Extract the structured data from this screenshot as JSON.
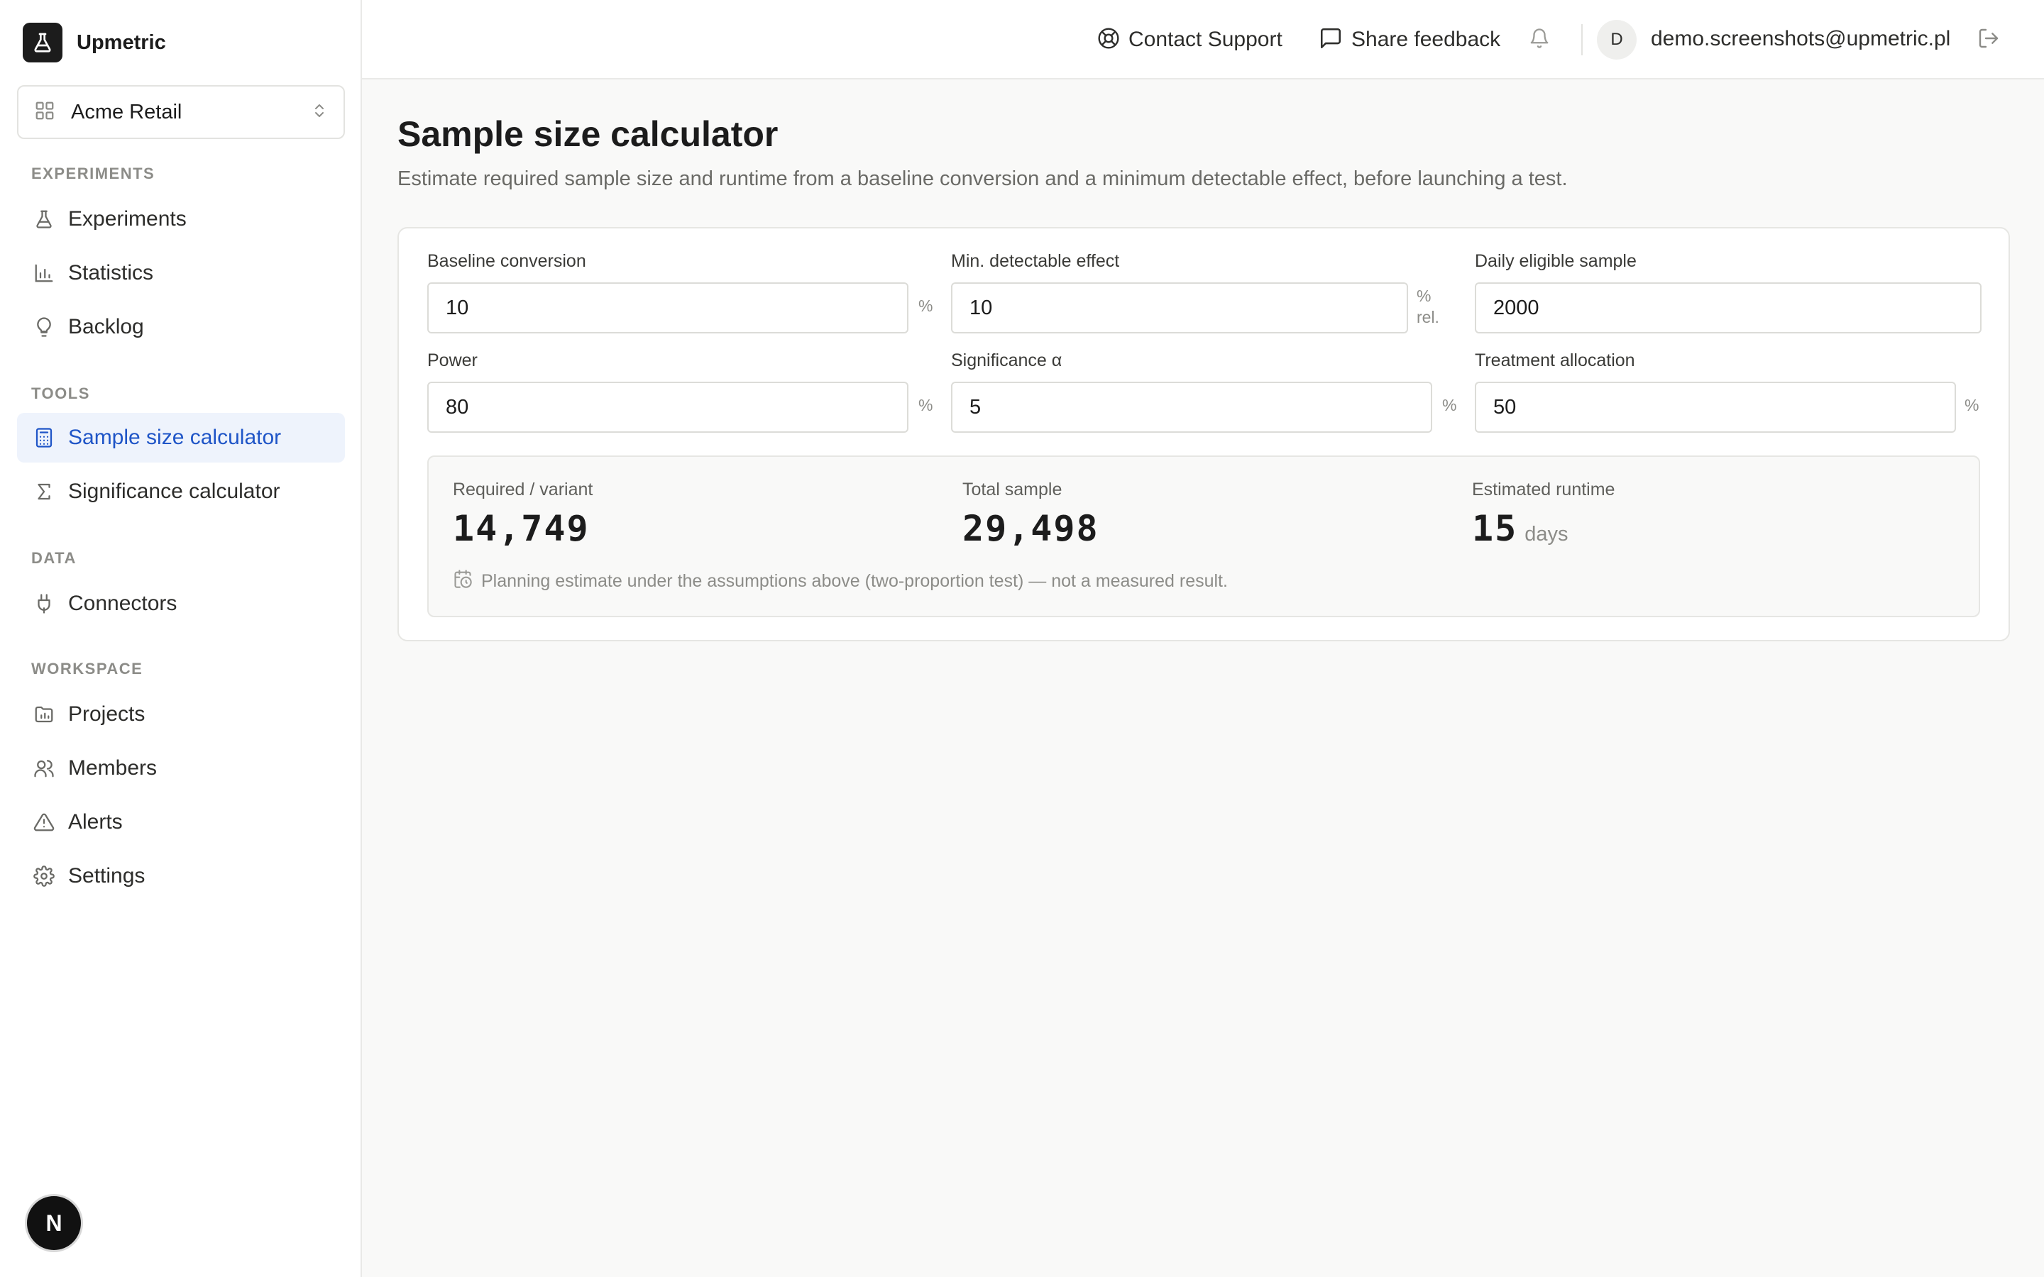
{
  "brand": {
    "name": "Upmetric"
  },
  "workspace": {
    "name": "Acme Retail"
  },
  "sidebar": {
    "sections": [
      {
        "title": "EXPERIMENTS",
        "items": [
          {
            "label": "Experiments",
            "icon": "flask-icon"
          },
          {
            "label": "Statistics",
            "icon": "bar-chart-icon"
          },
          {
            "label": "Backlog",
            "icon": "lightbulb-icon"
          }
        ]
      },
      {
        "title": "TOOLS",
        "items": [
          {
            "label": "Sample size calculator",
            "icon": "calculator-icon",
            "active": true
          },
          {
            "label": "Significance calculator",
            "icon": "sigma-icon"
          }
        ]
      },
      {
        "title": "DATA",
        "items": [
          {
            "label": "Connectors",
            "icon": "plug-icon"
          }
        ]
      },
      {
        "title": "WORKSPACE",
        "items": [
          {
            "label": "Projects",
            "icon": "folder-chart-icon"
          },
          {
            "label": "Members",
            "icon": "users-icon"
          },
          {
            "label": "Alerts",
            "icon": "alert-triangle-icon"
          },
          {
            "label": "Settings",
            "icon": "gear-icon"
          }
        ]
      }
    ]
  },
  "header": {
    "contact_support": "Contact Support",
    "share_feedback": "Share feedback",
    "avatar_initial": "D",
    "email": "demo.screenshots@upmetric.pl"
  },
  "page": {
    "title": "Sample size calculator",
    "subtitle": "Estimate required sample size and runtime from a baseline conversion and a minimum detectable effect, before launching a test."
  },
  "form": {
    "baseline": {
      "label": "Baseline conversion",
      "value": "10",
      "unit": "%"
    },
    "mde": {
      "label": "Min. detectable effect",
      "value": "10",
      "unit_line1": "%",
      "unit_line2": "rel."
    },
    "daily": {
      "label": "Daily eligible sample",
      "value": "2000"
    },
    "power": {
      "label": "Power",
      "value": "80",
      "unit": "%"
    },
    "alpha": {
      "label": "Significance α",
      "value": "5",
      "unit": "%"
    },
    "allocation": {
      "label": "Treatment allocation",
      "value": "50",
      "unit": "%"
    }
  },
  "results": {
    "per_variant": {
      "label": "Required / variant",
      "value": "14,749"
    },
    "total": {
      "label": "Total sample",
      "value": "29,498"
    },
    "runtime": {
      "label": "Estimated runtime",
      "value": "15",
      "unit": "days"
    },
    "note": "Planning estimate under the assumptions above (two-proportion test) — not a measured result."
  },
  "colors": {
    "accent": "#1f55c7",
    "active_bg": "#eef3fc",
    "text": "#1c1c1c",
    "muted": "#8c8c88"
  }
}
